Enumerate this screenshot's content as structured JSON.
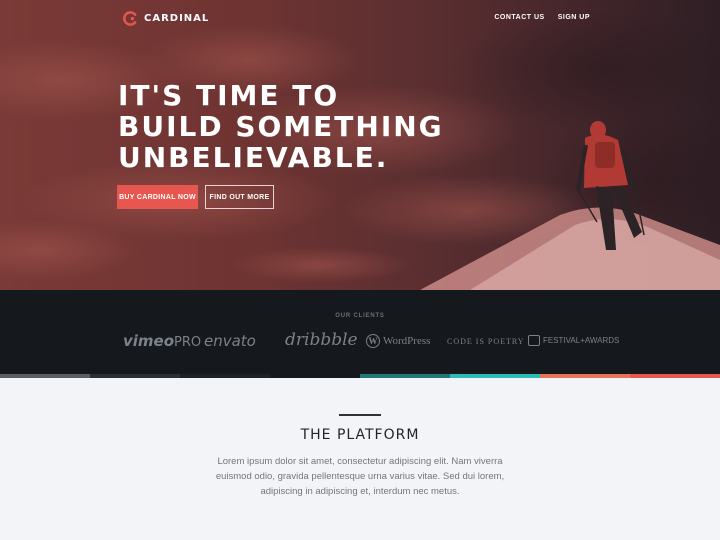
{
  "nav": {
    "brand": "CARDINAL",
    "links": [
      "CONTACT US",
      "SIGN UP"
    ]
  },
  "hero": {
    "headline": [
      "IT'S TIME TO",
      "BUILD SOMETHING",
      "UNBELIEVABLE."
    ],
    "primary_cta": "BUY CARDINAL NOW",
    "secondary_cta": "FIND OUT MORE"
  },
  "clients": {
    "label": "OUR CLIENTS",
    "logos": {
      "vimeo": "vimeo",
      "vimeo_pro": "PRO",
      "envato": "envato",
      "dribbble": "dribbble",
      "wordpress": "WordPress",
      "wordpress_mark": "W",
      "code_is_poetry": "CODE IS POETRY",
      "festival": "FESTIVAL+AWARDS"
    }
  },
  "strip_colors": [
    "#5a5f66",
    "#2a2f35",
    "#1d2227",
    "#15181c",
    "#1f7a72",
    "#2cbcb4",
    "#e7745a",
    "#e8574f"
  ],
  "platform": {
    "title": "THE PLATFORM",
    "body": "Lorem ipsum dolor sit amet, consectetur adipiscing elit. Nam viverra euismod odio, gravida pellentesque urna varius vitae. Sed dui lorem, adipiscing in adipiscing et, interdum nec metus."
  },
  "colors": {
    "accent": "#e8574f",
    "dark": "#15181c",
    "background": "#f3f4f7"
  }
}
